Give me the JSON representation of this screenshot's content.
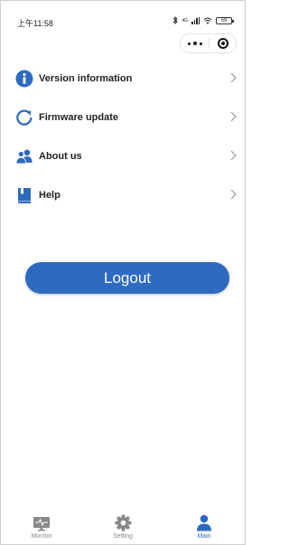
{
  "status_bar": {
    "time": "上午11:58",
    "network_label": "4G",
    "battery_level": "59"
  },
  "menu": {
    "items": [
      {
        "label": "Version information",
        "icon": "info-icon"
      },
      {
        "label": "Firmware update",
        "icon": "refresh-icon"
      },
      {
        "label": "About us",
        "icon": "users-icon"
      },
      {
        "label": "Help",
        "icon": "book-icon"
      }
    ]
  },
  "logout_label": "Logout",
  "tabbar": {
    "tabs": [
      {
        "label": "Monitor",
        "icon": "monitor-icon",
        "active": false
      },
      {
        "label": "Setting",
        "icon": "gear-icon",
        "active": false
      },
      {
        "label": "Main",
        "icon": "person-icon",
        "active": true
      }
    ]
  },
  "colors": {
    "accent": "#2e6bc0",
    "inactive": "#888888"
  }
}
